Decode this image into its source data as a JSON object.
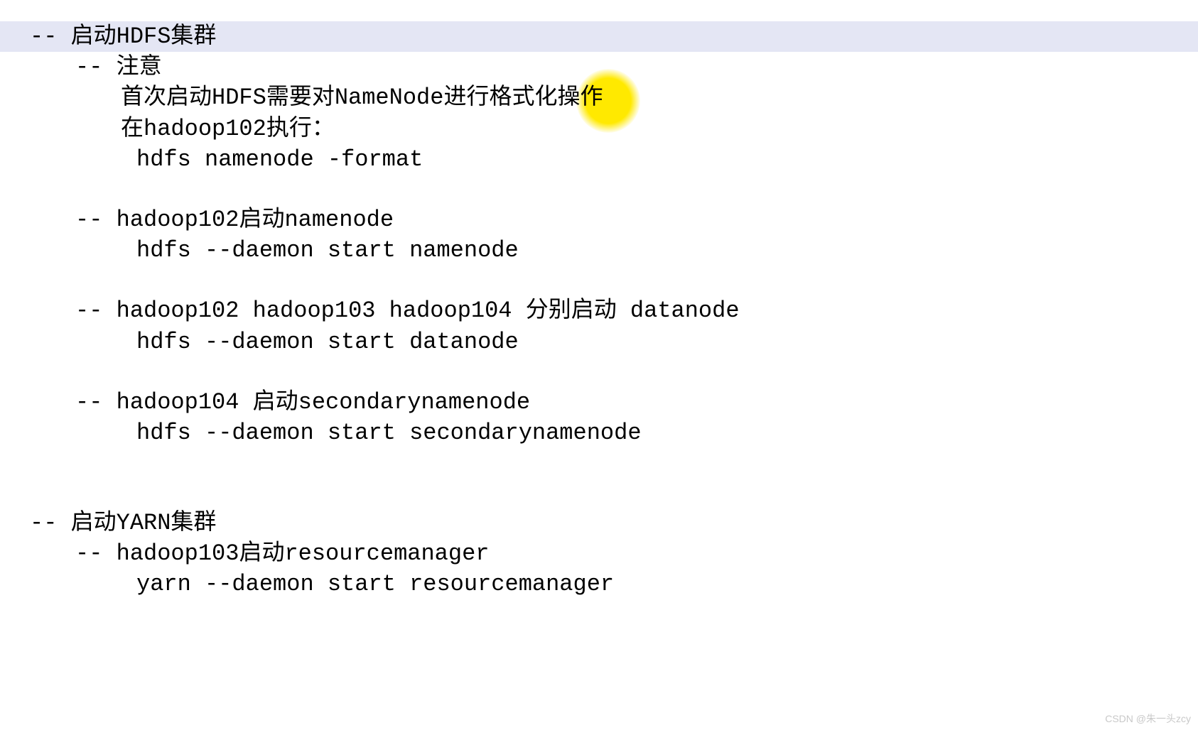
{
  "lines": {
    "l1": "-- 启动HDFS集群",
    "l2": "-- 注意",
    "l3": "首次启动HDFS需要对NameNode进行格式化操作",
    "l4": "在hadoop102执行：",
    "l5": "hdfs namenode -format",
    "l6": "-- hadoop102启动namenode",
    "l7": "hdfs --daemon start namenode",
    "l8": "-- hadoop102 hadoop103 hadoop104 分别启动 datanode",
    "l9": "hdfs --daemon start datanode",
    "l10": "-- hadoop104 启动secondarynamenode",
    "l11": "hdfs --daemon start secondarynamenode",
    "l12": "-- 启动YARN集群",
    "l13": "-- hadoop103启动resourcemanager",
    "l14": "yarn --daemon start resourcemanager"
  },
  "watermark": "CSDN @朱一头zcy"
}
